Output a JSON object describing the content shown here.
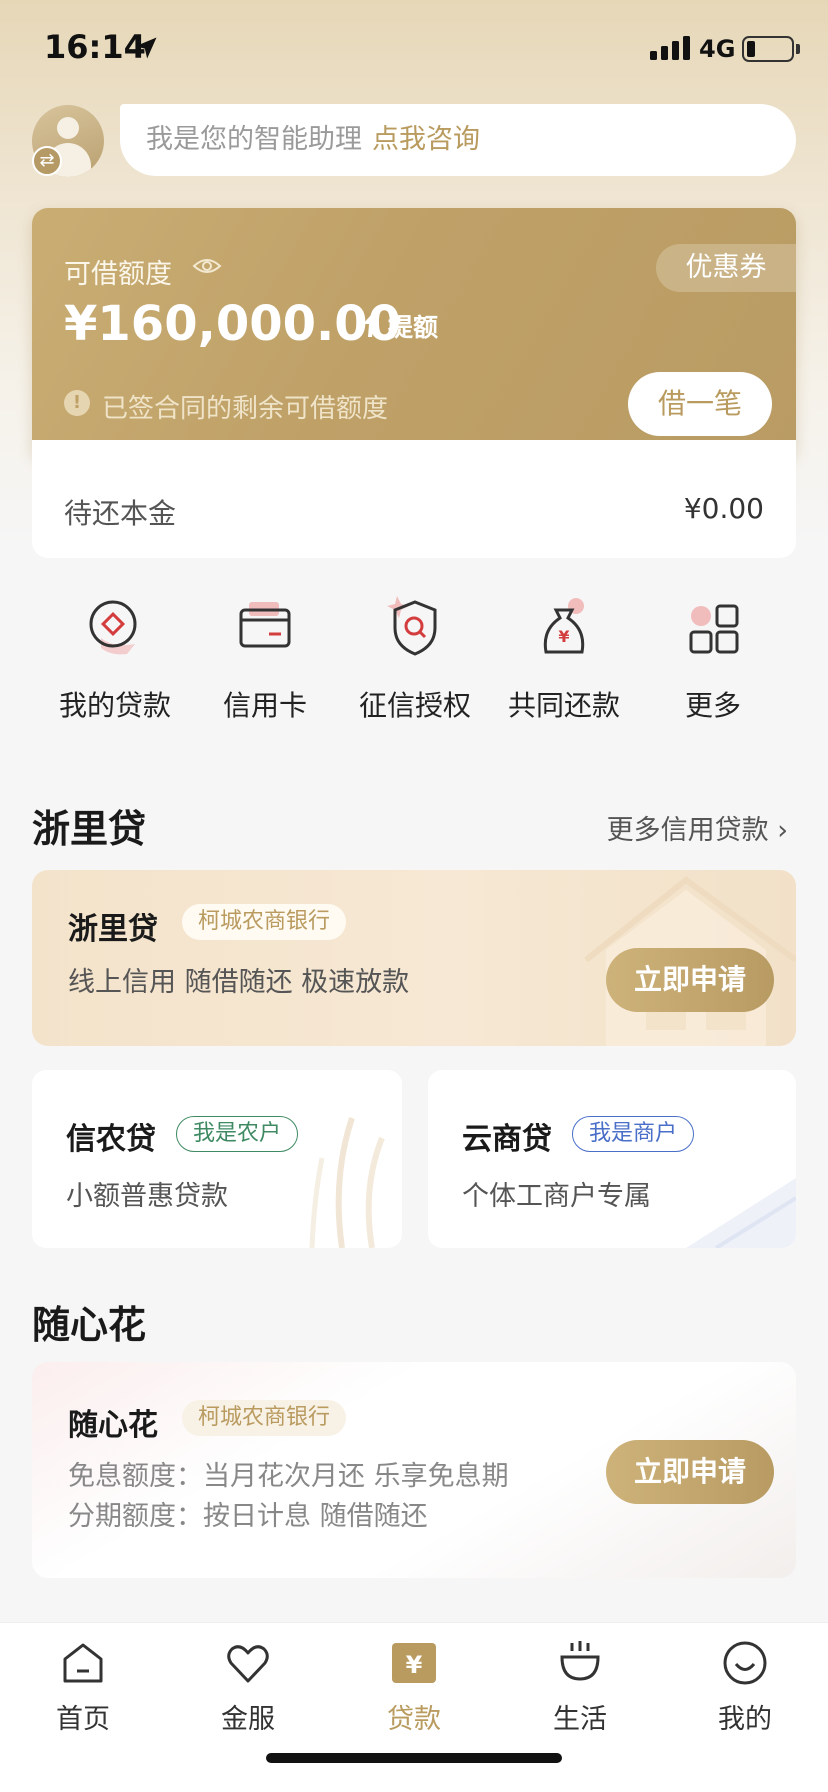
{
  "status_bar": {
    "time": "16:14",
    "network": "4G"
  },
  "assistant": {
    "text": "我是您的智能助理",
    "link": "点我咨询"
  },
  "credit": {
    "label": "可借额度",
    "amount": "¥160,000.00",
    "raise_label": "提额",
    "coupon_label": "优惠券",
    "note_icon": "!",
    "note": "已签合同的剩余可借额度",
    "borrow_label": "借一笔",
    "pending_label": "待还本金",
    "pending_value": "¥0.00"
  },
  "quick_actions": [
    {
      "label": "我的贷款",
      "icon": "loan-icon"
    },
    {
      "label": "信用卡",
      "icon": "credit-card-icon"
    },
    {
      "label": "征信授权",
      "icon": "shield-search-icon"
    },
    {
      "label": "共同还款",
      "icon": "money-bag-icon"
    },
    {
      "label": "更多",
      "icon": "grid-icon"
    }
  ],
  "section_zheli": {
    "title": "浙里贷",
    "more": "更多信用贷款 ›"
  },
  "zheli_card": {
    "title": "浙里贷",
    "bank_tag": "柯城农商银行",
    "desc": "线上信用 随借随还 极速放款",
    "apply": "立即申请"
  },
  "xinnong_card": {
    "title": "信农贷",
    "tag": "我是农户",
    "desc": "小额普惠贷款"
  },
  "yunshang_card": {
    "title": "云商贷",
    "tag": "我是商户",
    "desc": "个体工商户专属"
  },
  "section_sxh": {
    "title": "随心花"
  },
  "sxh_card": {
    "title": "随心花",
    "bank_tag": "柯城农商银行",
    "line1": "免息额度：当月花次月还 乐享免息期",
    "line2": "分期额度：按日计息 随借随还",
    "apply": "立即申请"
  },
  "bottom_nav": [
    {
      "label": "首页",
      "icon": "home-icon"
    },
    {
      "label": "金服",
      "icon": "heart-icon"
    },
    {
      "label": "贷款",
      "icon": "loan-yen-icon",
      "active": true
    },
    {
      "label": "生活",
      "icon": "cup-icon"
    },
    {
      "label": "我的",
      "icon": "smile-icon"
    }
  ],
  "colors": {
    "gold": "#b99b5f",
    "card_gold": "#c2a46b",
    "green": "#3f8a63",
    "blue": "#4a6fc8"
  }
}
